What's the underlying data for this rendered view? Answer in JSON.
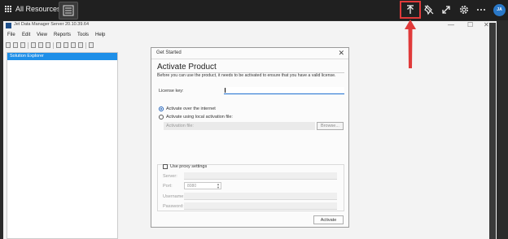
{
  "topbar": {
    "title": "All Resources",
    "icons": [
      "grid-icon",
      "list-icon",
      "upload-icon",
      "pin-off-icon",
      "expand-icon",
      "gear-icon",
      "more-icon"
    ],
    "avatar_initials": "JA",
    "highlight_color": "#e03a3a",
    "accent": "#2a78c8"
  },
  "app": {
    "title": "Jet Data Manager Server 20.10.39.64",
    "window_controls": [
      "—",
      "☐",
      "✕"
    ],
    "menu": [
      "File",
      "Edit",
      "View",
      "Reports",
      "Tools",
      "Help"
    ],
    "solution_explorer": "Solution Explorer",
    "selection_color": "#1e8fe8"
  },
  "dialog": {
    "window_title": "Get Started",
    "close": "✕",
    "heading": "Activate Product",
    "description": "Before you can use the product, it needs to be activated to ensure that you have a valid license.",
    "license_label": "License key:",
    "license_value": "",
    "radio_online": "Activate over the internet",
    "radio_local": "Activate using local activation file:",
    "activation_file_label": "Activation file:",
    "browse": "Browse...",
    "proxy_label": "Use proxy settings",
    "server_label": "Server:",
    "port_label": "Port:",
    "port_value": "8080",
    "username_label": "Username:",
    "password_label": "Password:",
    "activate": "Activate"
  },
  "annotation": {
    "arrow_color": "#e03a3a"
  }
}
